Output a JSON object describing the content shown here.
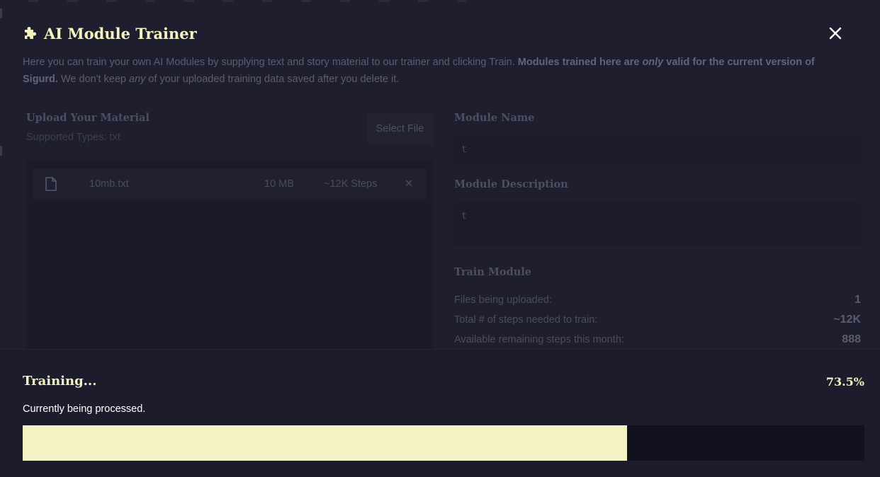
{
  "modal": {
    "title": "AI Module Trainer",
    "icons": {
      "title": "puzzle-icon",
      "close": "close-icon",
      "file": "file-icon",
      "remove": "close-icon"
    }
  },
  "description": {
    "part1": "Here you can train your own AI Modules by supplying text and story material to our trainer and clicking Train. ",
    "bold1": "Modules trained here are ",
    "bold_italic": "only",
    "bold2": " valid for the current version of Sigurd.",
    "part2": " We don't keep ",
    "italic": "any",
    "part3": " of your uploaded training data saved after you delete it."
  },
  "upload": {
    "label": "Upload Your Material",
    "types": "Supported Types: txt",
    "select_button": "Select File",
    "files": [
      {
        "name": "10mb.txt",
        "size": "10 MB",
        "steps": "~12K Steps",
        "remove": "✕"
      }
    ]
  },
  "module": {
    "name_label": "Module Name",
    "name_value": "t",
    "description_label": "Module Description",
    "description_value": "t"
  },
  "train": {
    "label": "Train Module",
    "stats": [
      {
        "label": "Files being uploaded:",
        "value": "1"
      },
      {
        "label": "Total # of steps needed to train:",
        "value": "~12K"
      },
      {
        "label": "Available remaining steps this month:",
        "value": "888"
      }
    ]
  },
  "progress": {
    "title": "Training...",
    "percent_label": "73.5%",
    "status": "Currently being processed.",
    "fraction": 0.718
  },
  "colors": {
    "accent": "#f5f3c2",
    "progress_fill": "#f2f2c4",
    "progress_track": "#111120",
    "background": "#1e1e2e"
  }
}
